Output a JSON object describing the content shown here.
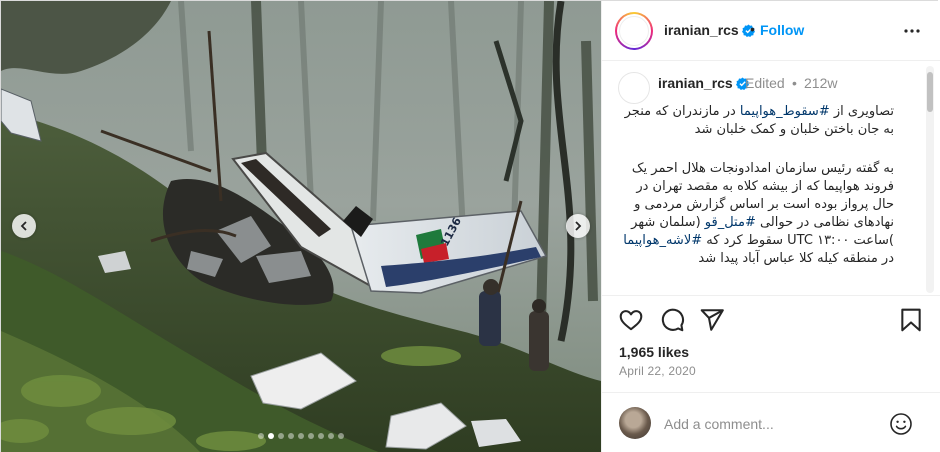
{
  "media": {
    "image_description": "helicopter-wreckage-in-misty-forest",
    "tail_number": "1136",
    "carousel": {
      "total_slides": 9,
      "active_index": 1
    }
  },
  "header": {
    "username": "iranian_rcs",
    "separator": "•",
    "follow_label": "Follow",
    "verified": true
  },
  "caption": {
    "username": "iranian_rcs",
    "edited_label": "Edited",
    "dot": "•",
    "time_ago": "212w",
    "p1_before": "تصاویری از ",
    "p1_hashtag": "#سقوط_هواپیما",
    "p1_after": " در مازندران که منجر به جان باختن خلبان و کمک خلبان شد",
    "p2_a": "به گفته رئیس سازمان امدادونجات هلال احمر یک فروند هواپیما که از بیشه کلاه به مقصد تهران در حال پرواز بوده است بر اساس گزارش مردمی و نهادهای نظامی در حوالی ",
    "p2_hashtag1": "#متل_قو",
    "p2_b": " (سلمان شهر )ساعت ۱۳:۰۰ UTC سقوط کرد که ",
    "p2_hashtag2": "#لاشه_هواپیما",
    "p2_c": " در منطقه کیله کلا عباس آباد پیدا شد"
  },
  "stats": {
    "likes": "1,965 likes",
    "date": "April 22, 2020"
  },
  "comment_box": {
    "placeholder": "Add a comment..."
  },
  "colors": {
    "link": "#0095f6",
    "hashtag": "#00376b",
    "brand_red": "#d1141d",
    "muted": "#8e8e8e"
  },
  "icons": [
    "heart-icon",
    "comment-icon",
    "share-icon",
    "bookmark-icon",
    "more-icon",
    "emoji-icon",
    "verified-icon",
    "chevron-left-icon",
    "chevron-right-icon"
  ]
}
